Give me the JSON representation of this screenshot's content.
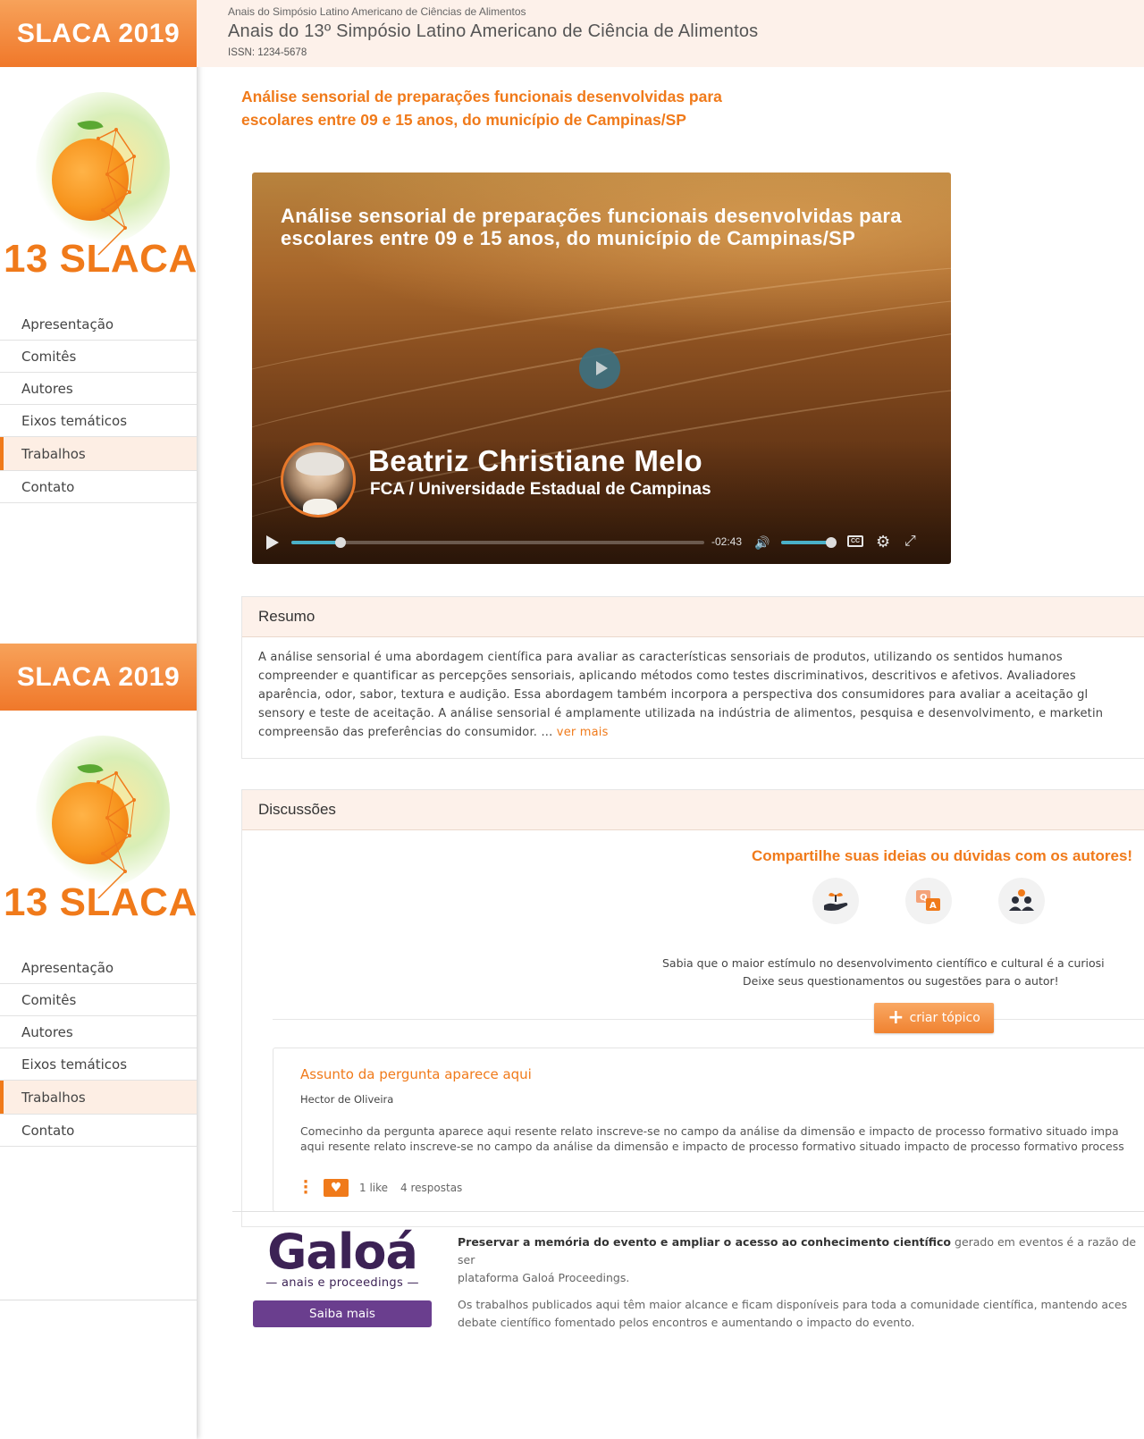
{
  "brand": {
    "event_short": "SLACA 2019",
    "logo_text": "13 SLACA"
  },
  "nav": {
    "items": [
      {
        "label": "Apresentação"
      },
      {
        "label": "Comitês"
      },
      {
        "label": "Autores"
      },
      {
        "label": "Eixos temáticos"
      },
      {
        "label": "Trabalhos",
        "active": true
      },
      {
        "label": "Contato"
      }
    ]
  },
  "header": {
    "pre": "Anais do Simpósio Latino Americano de Ciências de Alimentos",
    "title": "Anais do 13º Simpósio Latino Americano de Ciência de Alimentos",
    "issn": "ISSN: 1234-5678"
  },
  "work": {
    "title": "Análise sensorial de preparações funcionais desenvolvidas para escolares entre 09 e 15 anos, do município de Campinas/SP"
  },
  "video": {
    "title": "Análise sensorial de preparações funcionais desenvolvidas para escolares entre 09 e 15 anos, do município de Campinas/SP",
    "author": "Beatriz Christiane Melo",
    "institution": "FCA / Universidade Estadual de Campinas",
    "time_remaining": "-02:43",
    "progress_fraction": 0.12,
    "volume_fraction": 1.0,
    "cc_label": "CC"
  },
  "resumo": {
    "heading": "Resumo",
    "text": "A análise sensorial é uma abordagem científica para avaliar as características sensoriais de produtos, utilizando os sentidos humanos\ncompreender e quantificar as percepções sensoriais, aplicando métodos como testes discriminativos, descritivos e afetivos. Avaliadores\naparência, odor, sabor, textura e audição. Essa abordagem também incorpora a perspectiva dos consumidores para avaliar a aceitação gl\nsensory e teste de aceitação. A análise sensorial é amplamente utilizada na indústria de alimentos, pesquisa e desenvolvimento, e marketin\ncompreensão das preferências do consumidor. ... ",
    "more": "ver mais"
  },
  "discussoes": {
    "heading": "Discussões",
    "cta": "Compartilhe suas ideias ou dúvidas com os autores!",
    "info_line1": "Sabia que o maior estímulo no desenvolvimento científico e cultural é a curiosi",
    "info_line2": "Deixe seus questionamentos ou sugestões para o autor!",
    "create_label": "criar tópico",
    "topic": {
      "title": "Assunto da pergunta aparece aqui",
      "author": "Hector de Oliveira",
      "body_line1": "Comecinho da pergunta aparece aqui resente relato inscreve-se no campo da análise da dimensão e impacto de processo formativo situado impa",
      "body_line2": "aqui resente relato inscreve-se no campo da análise da dimensão e impacto de processo formativo situado impacto de processo formativo process",
      "likes": "1 like",
      "replies": "4 respostas"
    }
  },
  "footer": {
    "logo_word": "Galoá",
    "logo_sub": "anais e proceedings",
    "button": "Saiba mais",
    "p1_bold": "Preservar a memória do evento e ampliar o acesso ao conhecimento científico",
    "p1_rest": " gerado em eventos é a razão de ser\nplataforma Galoá Proceedings.",
    "p2": "Os trabalhos publicados aqui têm maior alcance e ficam disponíveis para toda a comunidade científica, mantendo aces\ndebate científico fomentado pelos encontros e aumentando o impacto do evento."
  },
  "colors": {
    "accent": "#f07a1a",
    "header_bg": "#fdf1ea",
    "galoa_purple": "#6a3e8e"
  }
}
